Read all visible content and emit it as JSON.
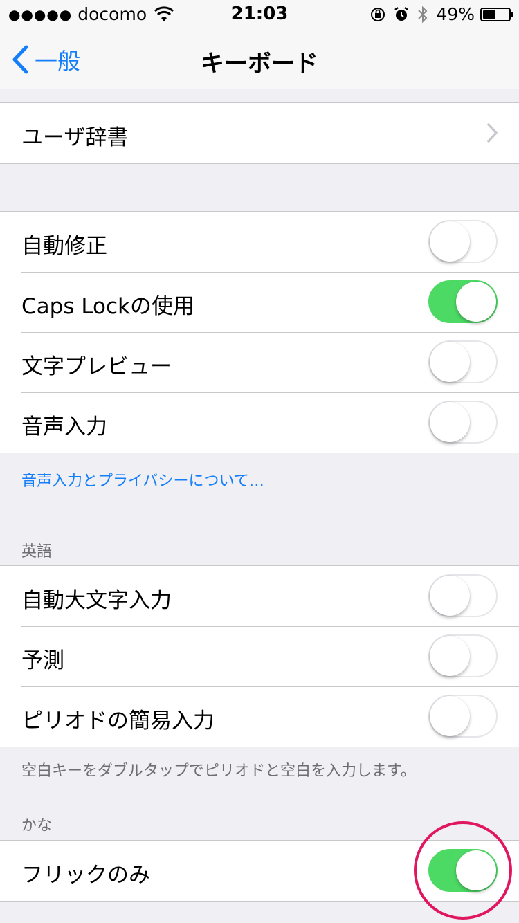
{
  "status_bar": {
    "signal": "●●●●●",
    "carrier": "docomo",
    "time": "21:03",
    "battery_percent": "49%",
    "battery_level": 0.49
  },
  "nav": {
    "back_label": "一般",
    "title": "キーボード"
  },
  "group1": {
    "rows": [
      {
        "label": "ユーザ辞書"
      }
    ]
  },
  "group2": {
    "rows": [
      {
        "label": "自動修正",
        "on": false
      },
      {
        "label": "Caps Lockの使用",
        "on": true
      },
      {
        "label": "文字プレビュー",
        "on": false
      },
      {
        "label": "音声入力",
        "on": false
      }
    ],
    "footer_link": "音声入力とプライバシーについて…"
  },
  "english": {
    "header": "英語",
    "rows": [
      {
        "label": "自動大文字入力",
        "on": false
      },
      {
        "label": "予測",
        "on": false
      },
      {
        "label": "ピリオドの簡易入力",
        "on": false
      }
    ],
    "footer": "空白キーをダブルタップでピリオドと空白を入力します。"
  },
  "kana": {
    "header": "かな",
    "rows": [
      {
        "label": "フリックのみ",
        "on": true
      }
    ]
  },
  "colors": {
    "toggle_on": "#4cd964",
    "link": "#157efb",
    "highlight": "#e0165e"
  }
}
